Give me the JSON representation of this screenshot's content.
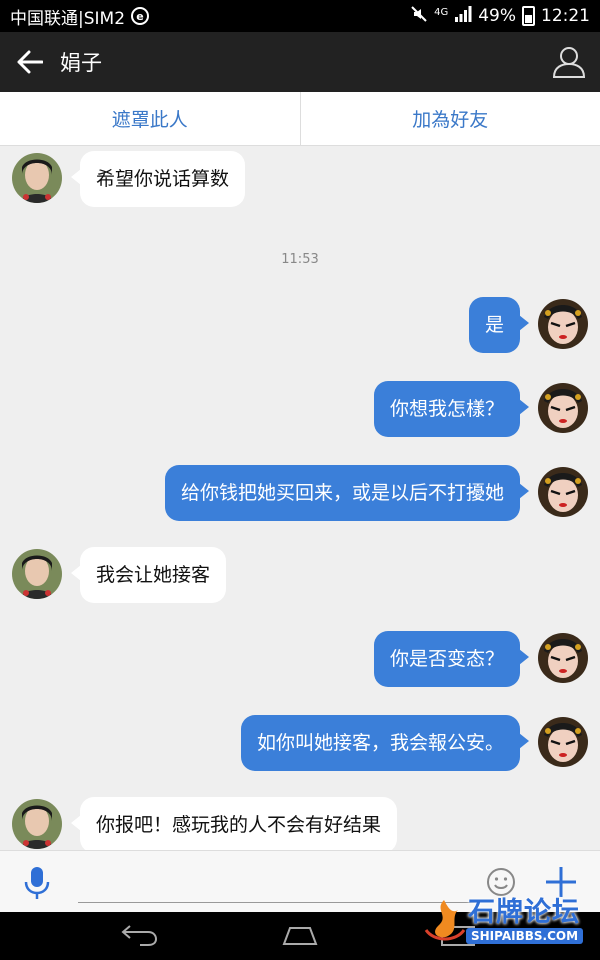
{
  "status_bar": {
    "carrier": "中国联通|SIM2",
    "badge": "e",
    "network": "4G",
    "battery": "49%",
    "time": "12:21"
  },
  "header": {
    "title": "娟子"
  },
  "actions": {
    "block": "遮罩此人",
    "add_friend": "加為好友"
  },
  "messages": [
    {
      "dir": "in",
      "text": "希望你说话算数"
    },
    {
      "dir": "time",
      "text": "11:53"
    },
    {
      "dir": "out",
      "text": "是"
    },
    {
      "dir": "out",
      "text": "你想我怎樣？"
    },
    {
      "dir": "out",
      "text": "给你钱把她买回来，或是以后不打擾她"
    },
    {
      "dir": "in",
      "text": "我会让她接客"
    },
    {
      "dir": "out",
      "text": "你是否变态？"
    },
    {
      "dir": "out",
      "text": "如你叫她接客，我会報公安。"
    },
    {
      "dir": "in",
      "text": "你报吧！感玩我的人不会有好结果"
    }
  ],
  "input": {
    "placeholder": ""
  },
  "watermark": {
    "name": "石牌论坛",
    "url": "SHIPAIBBS.COM"
  },
  "colors": {
    "outgoing_bubble": "#3b7fd9",
    "incoming_bubble": "#ffffff",
    "accent": "#3a78c8"
  }
}
